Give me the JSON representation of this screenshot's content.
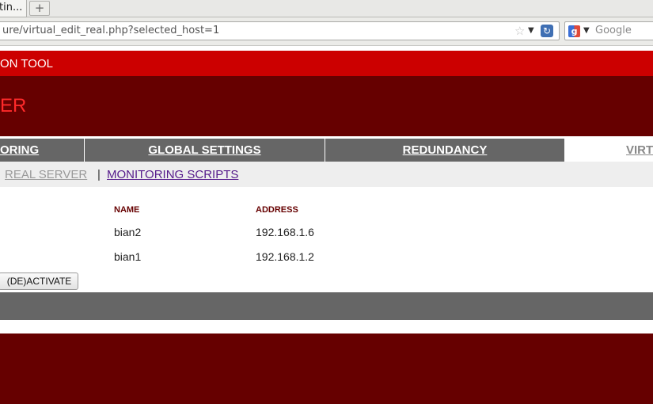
{
  "browser": {
    "tab_title": "tin...",
    "new_tab_symbol": "+",
    "url": "ure/virtual_edit_real.php?selected_host=1",
    "search_placeholder": "Google"
  },
  "header": {
    "top_title": "ON TOOL",
    "big_title": "ER"
  },
  "tabs": [
    {
      "label": "ORING"
    },
    {
      "label": "GLOBAL SETTINGS"
    },
    {
      "label": "REDUNDANCY"
    },
    {
      "label": "VIRT"
    }
  ],
  "subnav": {
    "current": "REAL SERVER",
    "separator": "|",
    "link": "MONITORING SCRIPTS"
  },
  "table": {
    "headers": {
      "name": "NAME",
      "address": "ADDRESS"
    },
    "rows": [
      {
        "name": "bian2",
        "address": "192.168.1.6"
      },
      {
        "name": "bian1",
        "address": "192.168.1.2"
      }
    ]
  },
  "actions": {
    "activate_label": "(DE)ACTIVATE"
  },
  "colors": {
    "top_band": "#cc0000",
    "dark_band": "#660000",
    "tab_bg": "#666666",
    "title_red": "#ff2a2a"
  }
}
